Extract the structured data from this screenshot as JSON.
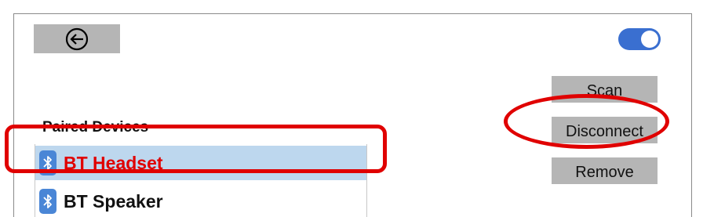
{
  "toolbar": {
    "back_icon": "back-arrow-icon",
    "toggle_state": "on",
    "toggle_color": "#3a6fd0"
  },
  "actions": {
    "scan_label": "Scan",
    "disconnect_label": "Disconnect",
    "remove_label": "Remove"
  },
  "paired": {
    "title": "Paired Devices",
    "devices": [
      {
        "label": "BT Headset",
        "icon": "bluetooth-icon",
        "selected": true
      },
      {
        "label": "BT Speaker",
        "icon": "bluetooth-icon",
        "selected": false
      }
    ]
  },
  "colors": {
    "selection": "#bdd7ee",
    "annotation": "#e00000",
    "button": "#b5b5b5"
  }
}
